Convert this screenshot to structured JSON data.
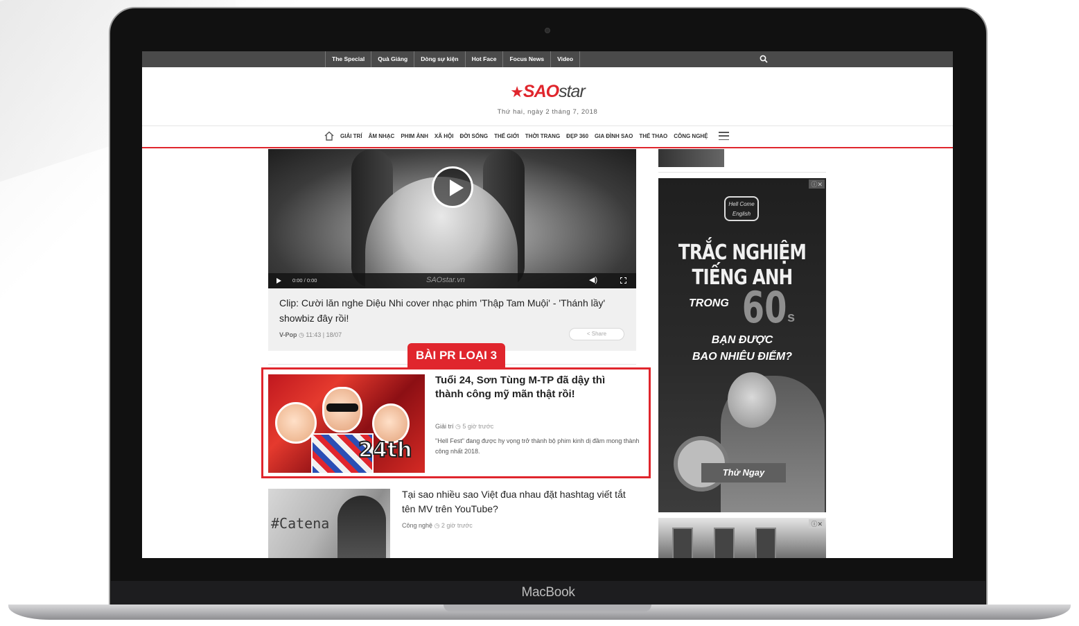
{
  "topbar": {
    "items": [
      "The Special",
      "Quà Giáng",
      "Dòng sự kiện",
      "Hot Face",
      "Focus News",
      "Video"
    ],
    "search_icon": "search-icon"
  },
  "header": {
    "logo_sao": "SAO",
    "logo_star": "star",
    "date": "Thứ hai, ngày 2 tháng 7, 2018"
  },
  "mainnav": {
    "items": [
      "GIẢI TRÍ",
      "ÂM NHẠC",
      "PHIM ẢNH",
      "XÃ HỘI",
      "ĐỜI SỐNG",
      "THẾ GIỚI",
      "THỜI TRANG",
      "ĐẸP 360",
      "GIA ĐÌNH SAO",
      "THỂ THAO",
      "CÔNG NGHỆ"
    ]
  },
  "video": {
    "time": "0:00 / 0:00",
    "watermark": "SAOstar.vn"
  },
  "card1": {
    "title": "Clip: Cười lăn nghe Diệu Nhi cover nhạc phim 'Thập Tam Muội' - 'Thánh lầy' showbiz đây rồi!",
    "category": "V-Pop",
    "time": "11:43 | 18/07",
    "share": "Share"
  },
  "pr": {
    "label": "BÀI PR LOẠI 3",
    "thumb_text": "24th",
    "title": "Tuổi 24, Sơn Tùng M-TP đã dậy thì thành công mỹ mãn thật rồi!",
    "category": "Giải trí",
    "time": "5 giờ trước",
    "desc": "\"Hell Fest\" đang được hy vọng trở thành bộ phim kinh dị đầm mong thành công nhất 2018."
  },
  "card3": {
    "thumb_text": "#Catena",
    "title": "Tại sao nhiều sao Việt đua nhau đặt hashtag viết tắt tên MV trên YouTube?",
    "category": "Công nghệ",
    "time": "2 giờ trước"
  },
  "ad": {
    "close": "ⓘ✕",
    "logo": "Hell Come English",
    "headline_1": "TRẮC NGHIỆM",
    "headline_2": "TIẾNG ANH",
    "trong": "TRONG",
    "num": "60",
    "unit": "s",
    "question_1": "BẠN ĐƯỢC",
    "question_2": "BAO NHIÊU ĐIỂM?",
    "button": "Thử Ngay"
  },
  "ad2": {
    "close": "ⓘ✕"
  },
  "device": {
    "brand": "MacBook"
  }
}
